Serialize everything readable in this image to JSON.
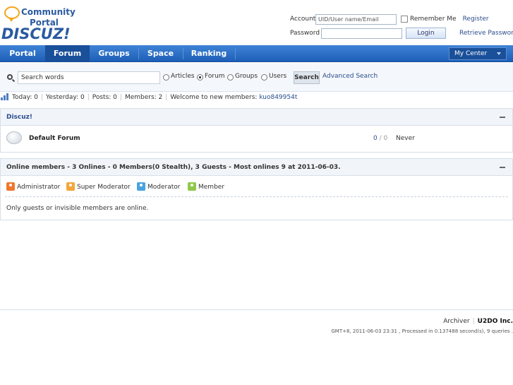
{
  "logo": {
    "line1": "Community",
    "line2": "Portal",
    "brand": "DISCUZ!"
  },
  "login": {
    "account_label": "Account",
    "account_placeholder": "UID/User name/Email",
    "remember_label": "Remember Me",
    "register_link": "Register",
    "password_label": "Password",
    "login_button": "Login",
    "retrieve_link": "Retrieve Password"
  },
  "nav": {
    "items": [
      {
        "label": "Portal"
      },
      {
        "label": "Forum",
        "active": true
      },
      {
        "label": "Groups"
      },
      {
        "label": "Space"
      },
      {
        "label": "Ranking"
      }
    ],
    "my_center": "My Center"
  },
  "search": {
    "placeholder": "Search words",
    "options": [
      {
        "label": "Articles",
        "checked": false
      },
      {
        "label": "Forum",
        "checked": true
      },
      {
        "label": "Groups",
        "checked": false
      },
      {
        "label": "Users",
        "checked": false
      }
    ],
    "button": "Search",
    "advanced": "Advanced Search"
  },
  "stats": {
    "today": "Today: 0",
    "yesterday": "Yesterday: 0",
    "posts": "Posts: 0",
    "members": "Members: 2",
    "welcome_prefix": "Welcome to new members:",
    "newest_member": "kuo849954t"
  },
  "category": {
    "title": "Discuz!",
    "forums": [
      {
        "name": "Default Forum",
        "threads": "0",
        "sep": "/",
        "posts": "0",
        "last_post": "Never"
      }
    ]
  },
  "online": {
    "title": "Online members - 3 Onlines - 0 Members(0 Stealth), 3 Guests - Most onlines 9 at 2011-06-03.",
    "legend": [
      {
        "label": "Administrator",
        "color": "#f0782d"
      },
      {
        "label": "Super Moderator",
        "color": "#f4a63b"
      },
      {
        "label": "Moderator",
        "color": "#4aa3df"
      },
      {
        "label": "Member",
        "color": "#8fc84a"
      }
    ],
    "note": "Only guests or invisible members are online."
  },
  "footer": {
    "archiver": "Archiver",
    "company": "U2DO Inc.",
    "info": "GMT+8, 2011-06-03 23:31 , Processed in 0.137488 second(s), 9 queries ."
  }
}
